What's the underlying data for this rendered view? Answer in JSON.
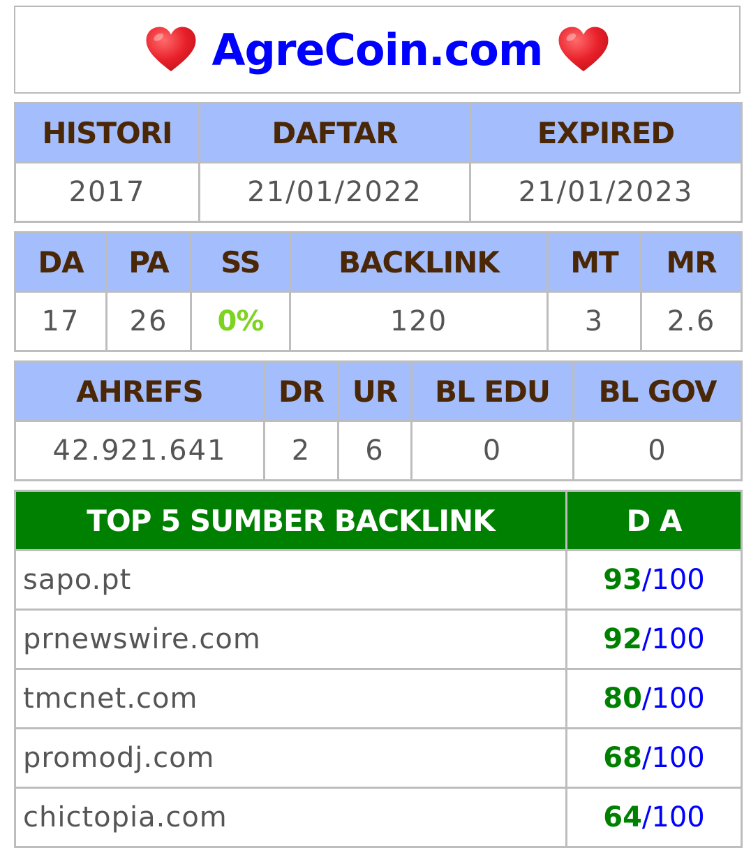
{
  "title": "AgreCoin.com",
  "colors": {
    "title": "#0000ff",
    "header_bg": "#a4bdfc",
    "header_text": "#4a2706",
    "top_header_bg": "#008000",
    "ss_value": "#7ed321",
    "score_value": "#008000",
    "score_max": "#0000ff",
    "heart": "#e8202a"
  },
  "icons": {
    "left": "heart-icon",
    "right": "heart-icon"
  },
  "registration": {
    "headers": [
      "HISTORI",
      "DAFTAR",
      "EXPIRED"
    ],
    "values": [
      "2017",
      "21/01/2022",
      "21/01/2023"
    ]
  },
  "metrics": {
    "headers": [
      "DA",
      "PA",
      "SS",
      "BACKLINK",
      "MT",
      "MR"
    ],
    "values": [
      "17",
      "26",
      "0%",
      "120",
      "3",
      "2.6"
    ]
  },
  "ahrefs": {
    "headers": [
      "AHREFS",
      "DR",
      "UR",
      "BL EDU",
      "BL GOV"
    ],
    "values": [
      "42.921.641",
      "2",
      "6",
      "0",
      "0"
    ]
  },
  "top_backlinks": {
    "headers": [
      "TOP 5 SUMBER BACKLINK",
      "D A"
    ],
    "separator": "/",
    "rows": [
      {
        "site": "sapo.pt",
        "score": "93",
        "max": "100"
      },
      {
        "site": "prnewswire.com",
        "score": "92",
        "max": "100"
      },
      {
        "site": "tmcnet.com",
        "score": "80",
        "max": "100"
      },
      {
        "site": "promodj.com",
        "score": "68",
        "max": "100"
      },
      {
        "site": "chictopia.com",
        "score": "64",
        "max": "100"
      }
    ]
  }
}
